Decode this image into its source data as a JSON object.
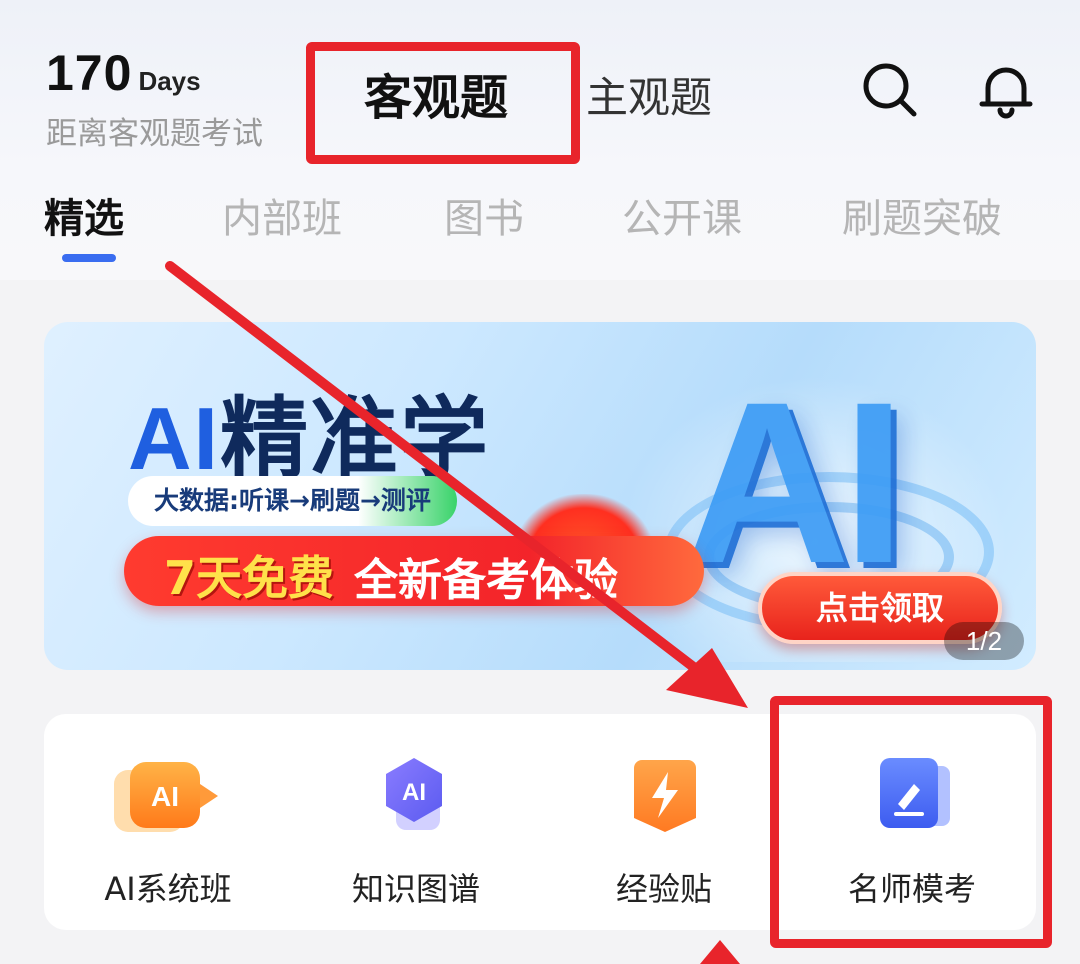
{
  "header": {
    "countdown_number": "170",
    "countdown_unit": "Days",
    "countdown_caption": "距离客观题考试",
    "mode_tabs": [
      {
        "label": "客观题",
        "active": true
      },
      {
        "label": "主观题",
        "active": false
      }
    ],
    "icons": [
      "search-icon",
      "bell-icon"
    ]
  },
  "category_tabs": [
    {
      "label": "精选",
      "active": true
    },
    {
      "label": "内部班",
      "active": false
    },
    {
      "label": "图书",
      "active": false
    },
    {
      "label": "公开课",
      "active": false
    },
    {
      "label": "刷题突破",
      "active": false
    }
  ],
  "banner": {
    "title_ai": "AI",
    "title_rest": "精准学",
    "pill_text": "大数据:听课→刷题→测评",
    "strip_highlight": "7天免费",
    "strip_rest": "全新备考体验",
    "big_graphic_text": "AI",
    "claim_button": "点击领取",
    "page_indicator": "1/2"
  },
  "features": [
    {
      "label": "AI系统班",
      "icon": "ai-class-icon",
      "icon_text": "AI"
    },
    {
      "label": "知识图谱",
      "icon": "knowledge-graph-icon",
      "icon_text": "AI"
    },
    {
      "label": "经验贴",
      "icon": "lightning-icon"
    },
    {
      "label": "名师模考",
      "icon": "edit-exam-icon"
    }
  ],
  "colors": {
    "accent_blue": "#3a6df0",
    "annotation_red": "#e8242b",
    "banner_red": "#f3242a"
  }
}
